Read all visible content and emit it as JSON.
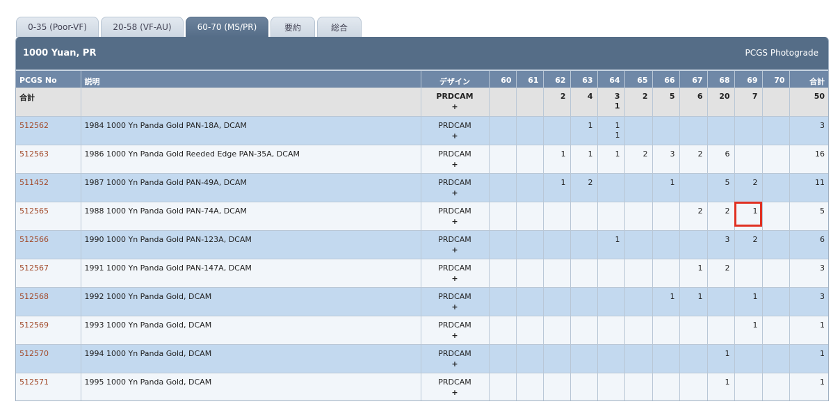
{
  "tabs": [
    {
      "label": "0-35 (Poor-VF)",
      "active": false
    },
    {
      "label": "20-58 (VF-AU)",
      "active": false
    },
    {
      "label": "60-70 (MS/PR)",
      "active": true
    },
    {
      "label": "要約",
      "active": false
    },
    {
      "label": "総合",
      "active": false
    }
  ],
  "header": {
    "title": "1000 Yuan, PR",
    "photograde": "PCGS Photograde"
  },
  "columns": [
    "PCGS No",
    "説明",
    "デザイン",
    "60",
    "61",
    "62",
    "63",
    "64",
    "65",
    "66",
    "67",
    "68",
    "69",
    "70",
    "合計"
  ],
  "total_row": {
    "label": "合計",
    "design": "PRDCAM",
    "design_plus": "+",
    "grades": [
      "",
      "",
      "2",
      "4",
      "3\n1",
      "2",
      "5",
      "6",
      "20",
      "7",
      ""
    ],
    "total": "50"
  },
  "rows": [
    {
      "pcgs": "512562",
      "desc": "1984 1000 Yn Panda Gold PAN-18A, DCAM",
      "design": "PRDCAM",
      "design_plus": "+",
      "grades": [
        "",
        "",
        "",
        "1",
        "1\n1",
        "",
        "",
        "",
        "",
        "",
        ""
      ],
      "total": "3"
    },
    {
      "pcgs": "512563",
      "desc": "1986 1000 Yn Panda Gold Reeded Edge PAN-35A, DCAM",
      "design": "PRDCAM",
      "design_plus": "+",
      "grades": [
        "",
        "",
        "1",
        "1",
        "1",
        "2",
        "3",
        "2",
        "6",
        "",
        ""
      ],
      "total": "16"
    },
    {
      "pcgs": "511452",
      "desc": "1987 1000 Yn Panda Gold PAN-49A, DCAM",
      "design": "PRDCAM",
      "design_plus": "+",
      "grades": [
        "",
        "",
        "1",
        "2",
        "",
        "",
        "1",
        "",
        "5",
        "2",
        ""
      ],
      "total": "11"
    },
    {
      "pcgs": "512565",
      "desc": "1988 1000 Yn Panda Gold PAN-74A, DCAM",
      "design": "PRDCAM",
      "design_plus": "+",
      "grades": [
        "",
        "",
        "",
        "",
        "",
        "",
        "",
        "2",
        "2",
        "1",
        ""
      ],
      "total": "5"
    },
    {
      "pcgs": "512566",
      "desc": "1990 1000 Yn Panda Gold PAN-123A, DCAM",
      "design": "PRDCAM",
      "design_plus": "+",
      "grades": [
        "",
        "",
        "",
        "",
        "1",
        "",
        "",
        "",
        "3",
        "2",
        ""
      ],
      "total": "6"
    },
    {
      "pcgs": "512567",
      "desc": "1991 1000 Yn Panda Gold PAN-147A, DCAM",
      "design": "PRDCAM",
      "design_plus": "+",
      "grades": [
        "",
        "",
        "",
        "",
        "",
        "",
        "",
        "1",
        "2",
        "",
        ""
      ],
      "total": "3"
    },
    {
      "pcgs": "512568",
      "desc": "1992 1000 Yn Panda Gold, DCAM",
      "design": "PRDCAM",
      "design_plus": "+",
      "grades": [
        "",
        "",
        "",
        "",
        "",
        "",
        "1",
        "1",
        "",
        "1",
        ""
      ],
      "total": "3"
    },
    {
      "pcgs": "512569",
      "desc": "1993 1000 Yn Panda Gold, DCAM",
      "design": "PRDCAM",
      "design_plus": "+",
      "grades": [
        "",
        "",
        "",
        "",
        "",
        "",
        "",
        "",
        "",
        "1",
        ""
      ],
      "total": "1"
    },
    {
      "pcgs": "512570",
      "desc": "1994 1000 Yn Panda Gold, DCAM",
      "design": "PRDCAM",
      "design_plus": "+",
      "grades": [
        "",
        "",
        "",
        "",
        "",
        "",
        "",
        "",
        "1",
        "",
        ""
      ],
      "total": "1"
    },
    {
      "pcgs": "512571",
      "desc": "1995 1000 Yn Panda Gold, DCAM",
      "design": "PRDCAM",
      "design_plus": "+",
      "grades": [
        "",
        "",
        "",
        "",
        "",
        "",
        "",
        "",
        "1",
        "",
        ""
      ],
      "total": "1"
    }
  ],
  "highlight_color": "#e03021"
}
